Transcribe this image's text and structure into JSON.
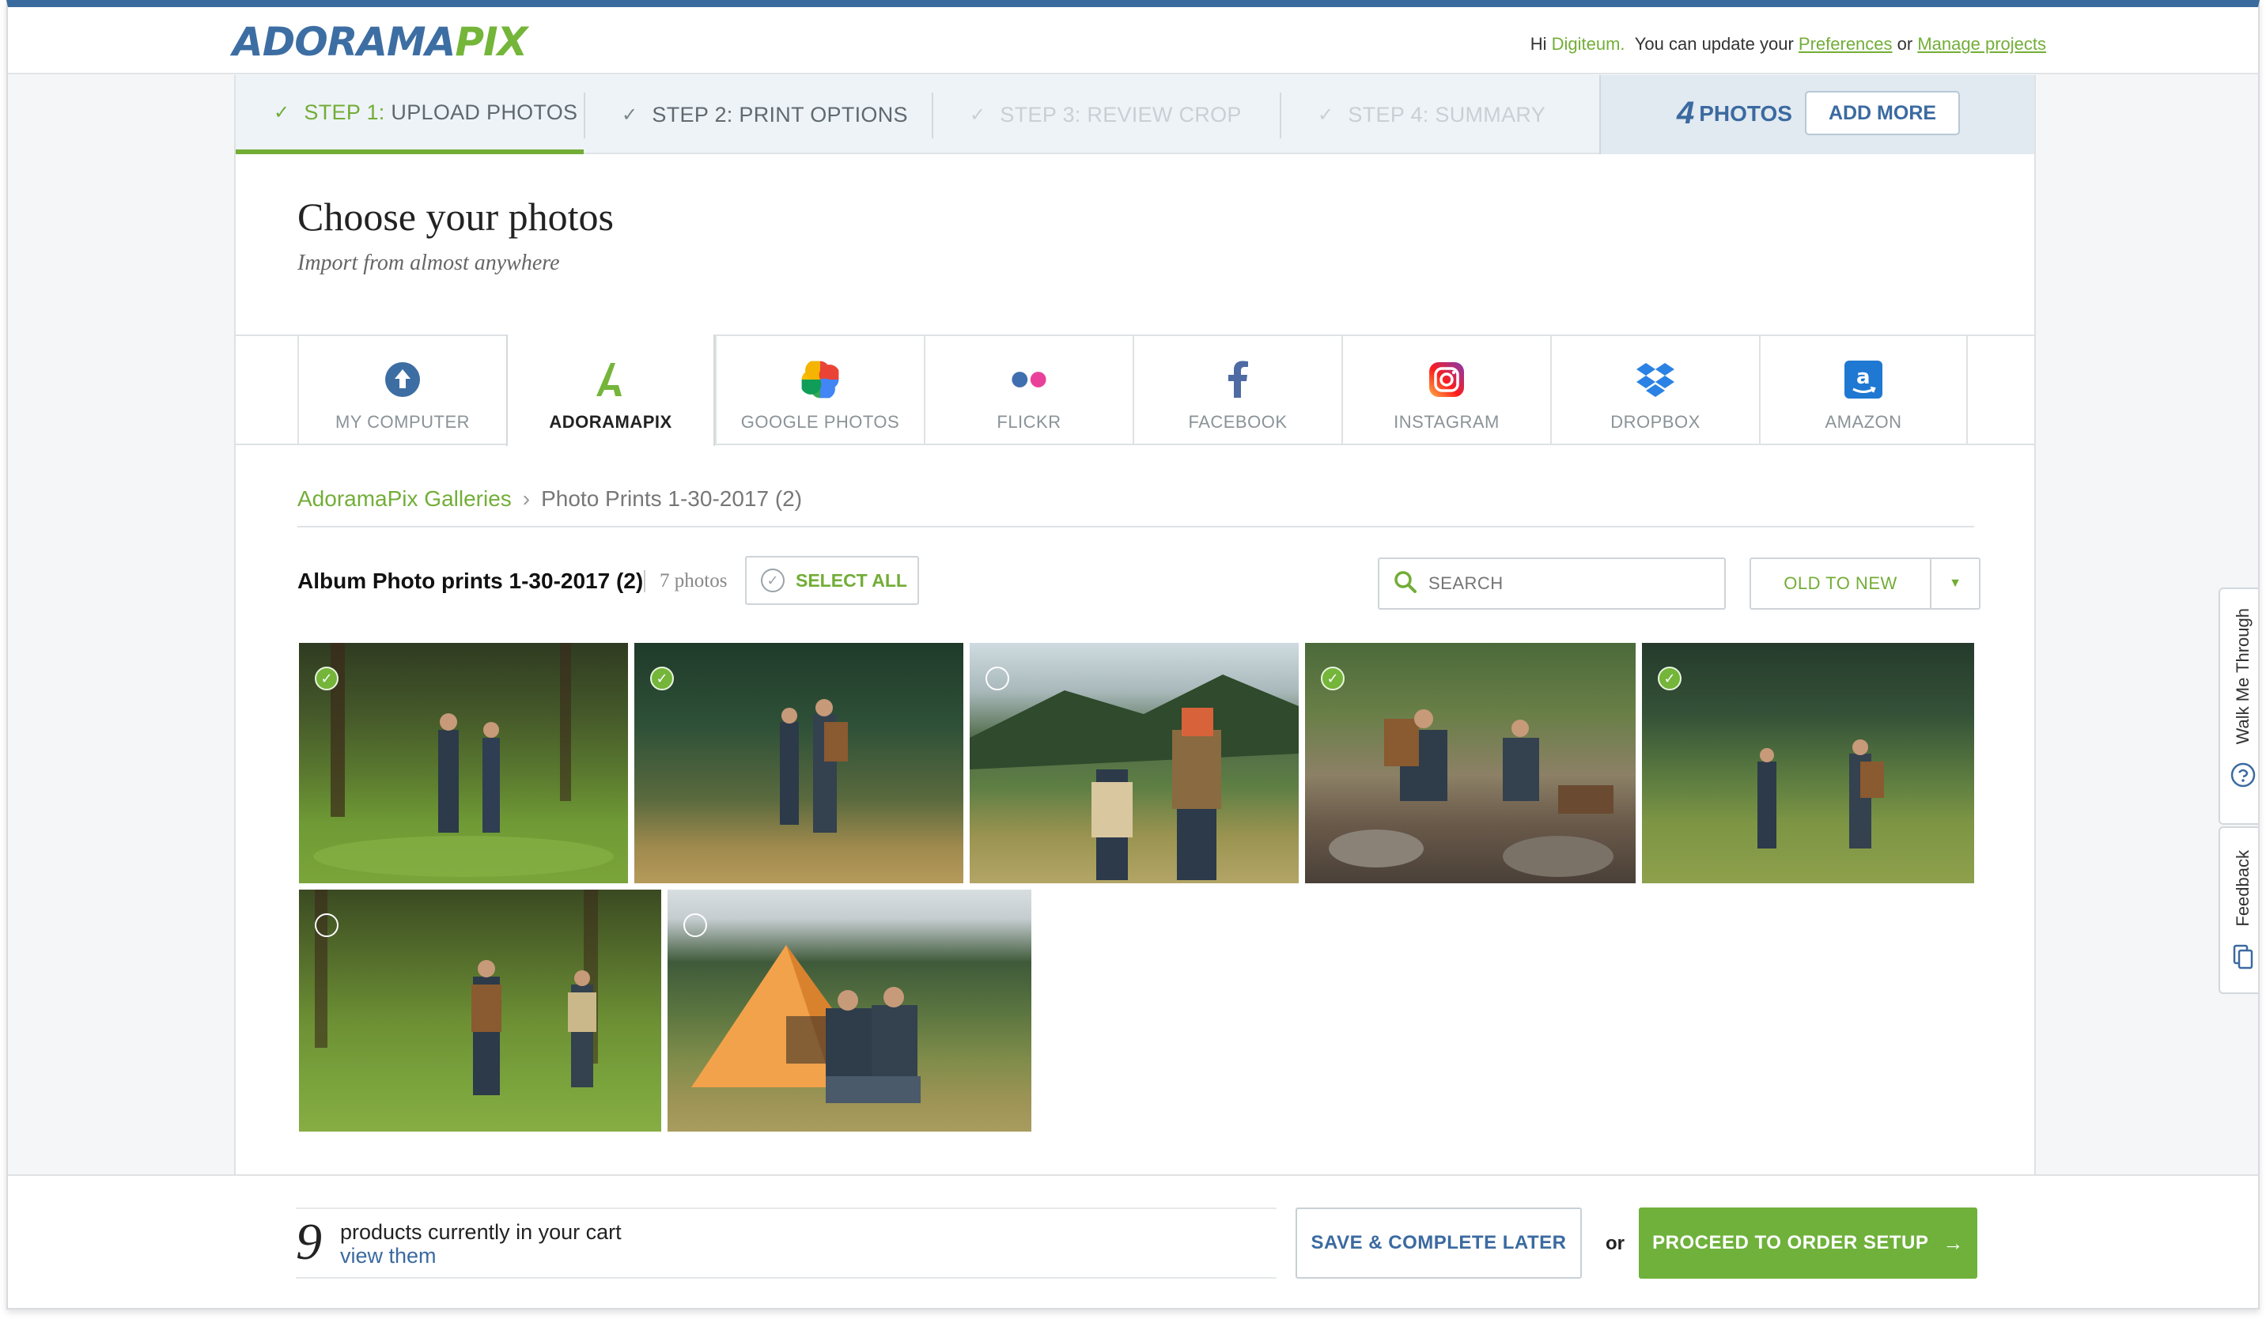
{
  "brand": {
    "logo_part1": "ADORAMA",
    "logo_part2": "PIX"
  },
  "header": {
    "greeting_prefix": "Hi",
    "user_name": "Digiteum.",
    "update_text": "You can update your",
    "preferences_link": "Preferences",
    "or_text": "or",
    "manage_link": "Manage projects"
  },
  "steps": [
    {
      "prefix": "STEP 1:",
      "label": "UPLOAD PHOTOS",
      "state": "active"
    },
    {
      "prefix": "STEP 2:",
      "label": "PRINT OPTIONS",
      "state": "done"
    },
    {
      "prefix": "STEP 3:",
      "label": "REVIEW CROP",
      "state": "disabled"
    },
    {
      "prefix": "STEP 4:",
      "label": "SUMMARY",
      "state": "disabled"
    }
  ],
  "photo_summary": {
    "count": "4",
    "label": "PHOTOS",
    "add_more": "ADD MORE"
  },
  "page": {
    "title": "Choose your photos",
    "subtitle": "Import from almost anywhere"
  },
  "sources": [
    {
      "label": "MY COMPUTER",
      "icon": "upload-icon"
    },
    {
      "label": "ADORAMAPIX",
      "icon": "adoramapix-icon"
    },
    {
      "label": "GOOGLE PHOTOS",
      "icon": "google-photos-icon"
    },
    {
      "label": "FLICKR",
      "icon": "flickr-icon"
    },
    {
      "label": "FACEBOOK",
      "icon": "facebook-icon"
    },
    {
      "label": "INSTAGRAM",
      "icon": "instagram-icon"
    },
    {
      "label": "DROPBOX",
      "icon": "dropbox-icon"
    },
    {
      "label": "AMAZON",
      "icon": "amazon-icon"
    }
  ],
  "breadcrumb": {
    "root": "AdoramaPix Galleries",
    "current": "Photo Prints 1-30-2017 (2)"
  },
  "album": {
    "title": "Album Photo prints 1-30-2017 (2)",
    "count": "7 photos",
    "select_all": "SELECT ALL",
    "search_placeholder": "SEARCH",
    "sort_label": "OLD TO NEW"
  },
  "photos": [
    {
      "selected": true
    },
    {
      "selected": true
    },
    {
      "selected": false
    },
    {
      "selected": true
    },
    {
      "selected": true
    },
    {
      "selected": false
    },
    {
      "selected": false
    }
  ],
  "footer": {
    "cart_count": "9",
    "cart_text": "products currently in your cart",
    "cart_link": "view them",
    "save_later": "SAVE & COMPLETE LATER",
    "or_text": "or",
    "proceed": "PROCEED TO ORDER SETUP"
  },
  "side_tabs": {
    "walk_me": "Walk Me Through",
    "feedback": "Feedback"
  },
  "colors": {
    "accent_green": "#72ad36",
    "brand_blue": "#3b6aa0",
    "top_border": "#3a6b9e"
  }
}
